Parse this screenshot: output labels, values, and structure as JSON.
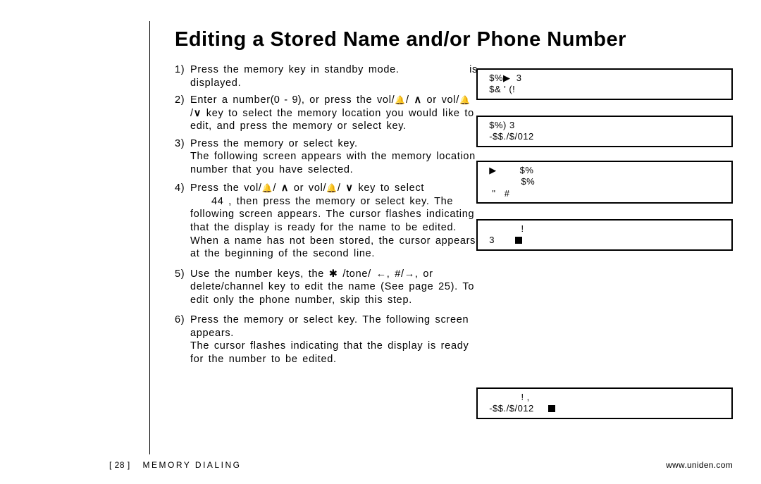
{
  "title": "Editing a Stored Name and/or Phone Number",
  "footer": {
    "page": "[ 28 ]",
    "section": "MEMORY DIALING",
    "url": "www.uniden.com"
  },
  "steps": {
    "s1": {
      "num": "1)",
      "t1": "Press the",
      "t2": "memory",
      "t3": "key in standby mode.",
      "t4": "is",
      "t5": "displayed."
    },
    "s2": {
      "num": "2)",
      "t1": "Enter a number",
      "range": "(0 - 9)",
      "t2": ", or press the",
      "t3": "vol/",
      "t4": " or vol/",
      "t5": "/",
      "t6": " key to select the memory location you would like to edit, and press the",
      "t7": "memory",
      "t8": "or",
      "t9": "select",
      "t10": "key."
    },
    "s3": {
      "num": "3)",
      "t1": "Press the",
      "t2": "memory",
      "t3": "or",
      "t4": "select",
      "t5": "key.",
      "t6": "The following screen appears with the memory location number that you have selected."
    },
    "s4": {
      "num": "4)",
      "t1": "Press the",
      "t2": "vol/",
      "t3": " or vol/",
      "t4": " key to select",
      "t5": "44",
      "t6": ", then press the",
      "t7": "memory",
      "t8": "or",
      "t9": "select",
      "t10": "key. The",
      "t11": "following screen appears. The cursor flashes indicating that the display is ready for the name to be edited. When a name has not been stored, the cursor appears at the beginning of the second line."
    },
    "s5": {
      "num": "5)",
      "t1": "Use the number keys, the",
      "t2": " /tone/ ",
      "t3": ", #/",
      "t4": ", or",
      "t5": "delete/channel",
      "t6": " key to edit the name (See page 25). To edit only the phone number, skip this step."
    },
    "s6": {
      "num": "6)",
      "t1": "Press the",
      "t2": "memory",
      "t3": "or",
      "t4": "select",
      "t5": "key. The following screen appears.",
      "t6": "The cursor flashes indicating that the display is ready for the number to be edited."
    }
  },
  "icons": {
    "bell": "🔔",
    "up": "∧",
    "down": "∨",
    "star": "✱",
    "left": "←",
    "right": "→"
  },
  "lcd": {
    "d1": {
      "l1": "  $%▶  3",
      "l2": "  $& ' (!"
    },
    "d2": {
      "l1": "  $%) 3",
      "l2": "  -$$./$/012"
    },
    "d3": {
      "l1": "  ▶        $%",
      "l2": "             $%",
      "l3": "   \"   #"
    },
    "d4": {
      "l1": "             !",
      "l2": "  3       ",
      "cursor": true
    },
    "d5": {
      "l1": "             ! ,",
      "l2": "  -$$./$/012     ",
      "cursor": true
    }
  }
}
